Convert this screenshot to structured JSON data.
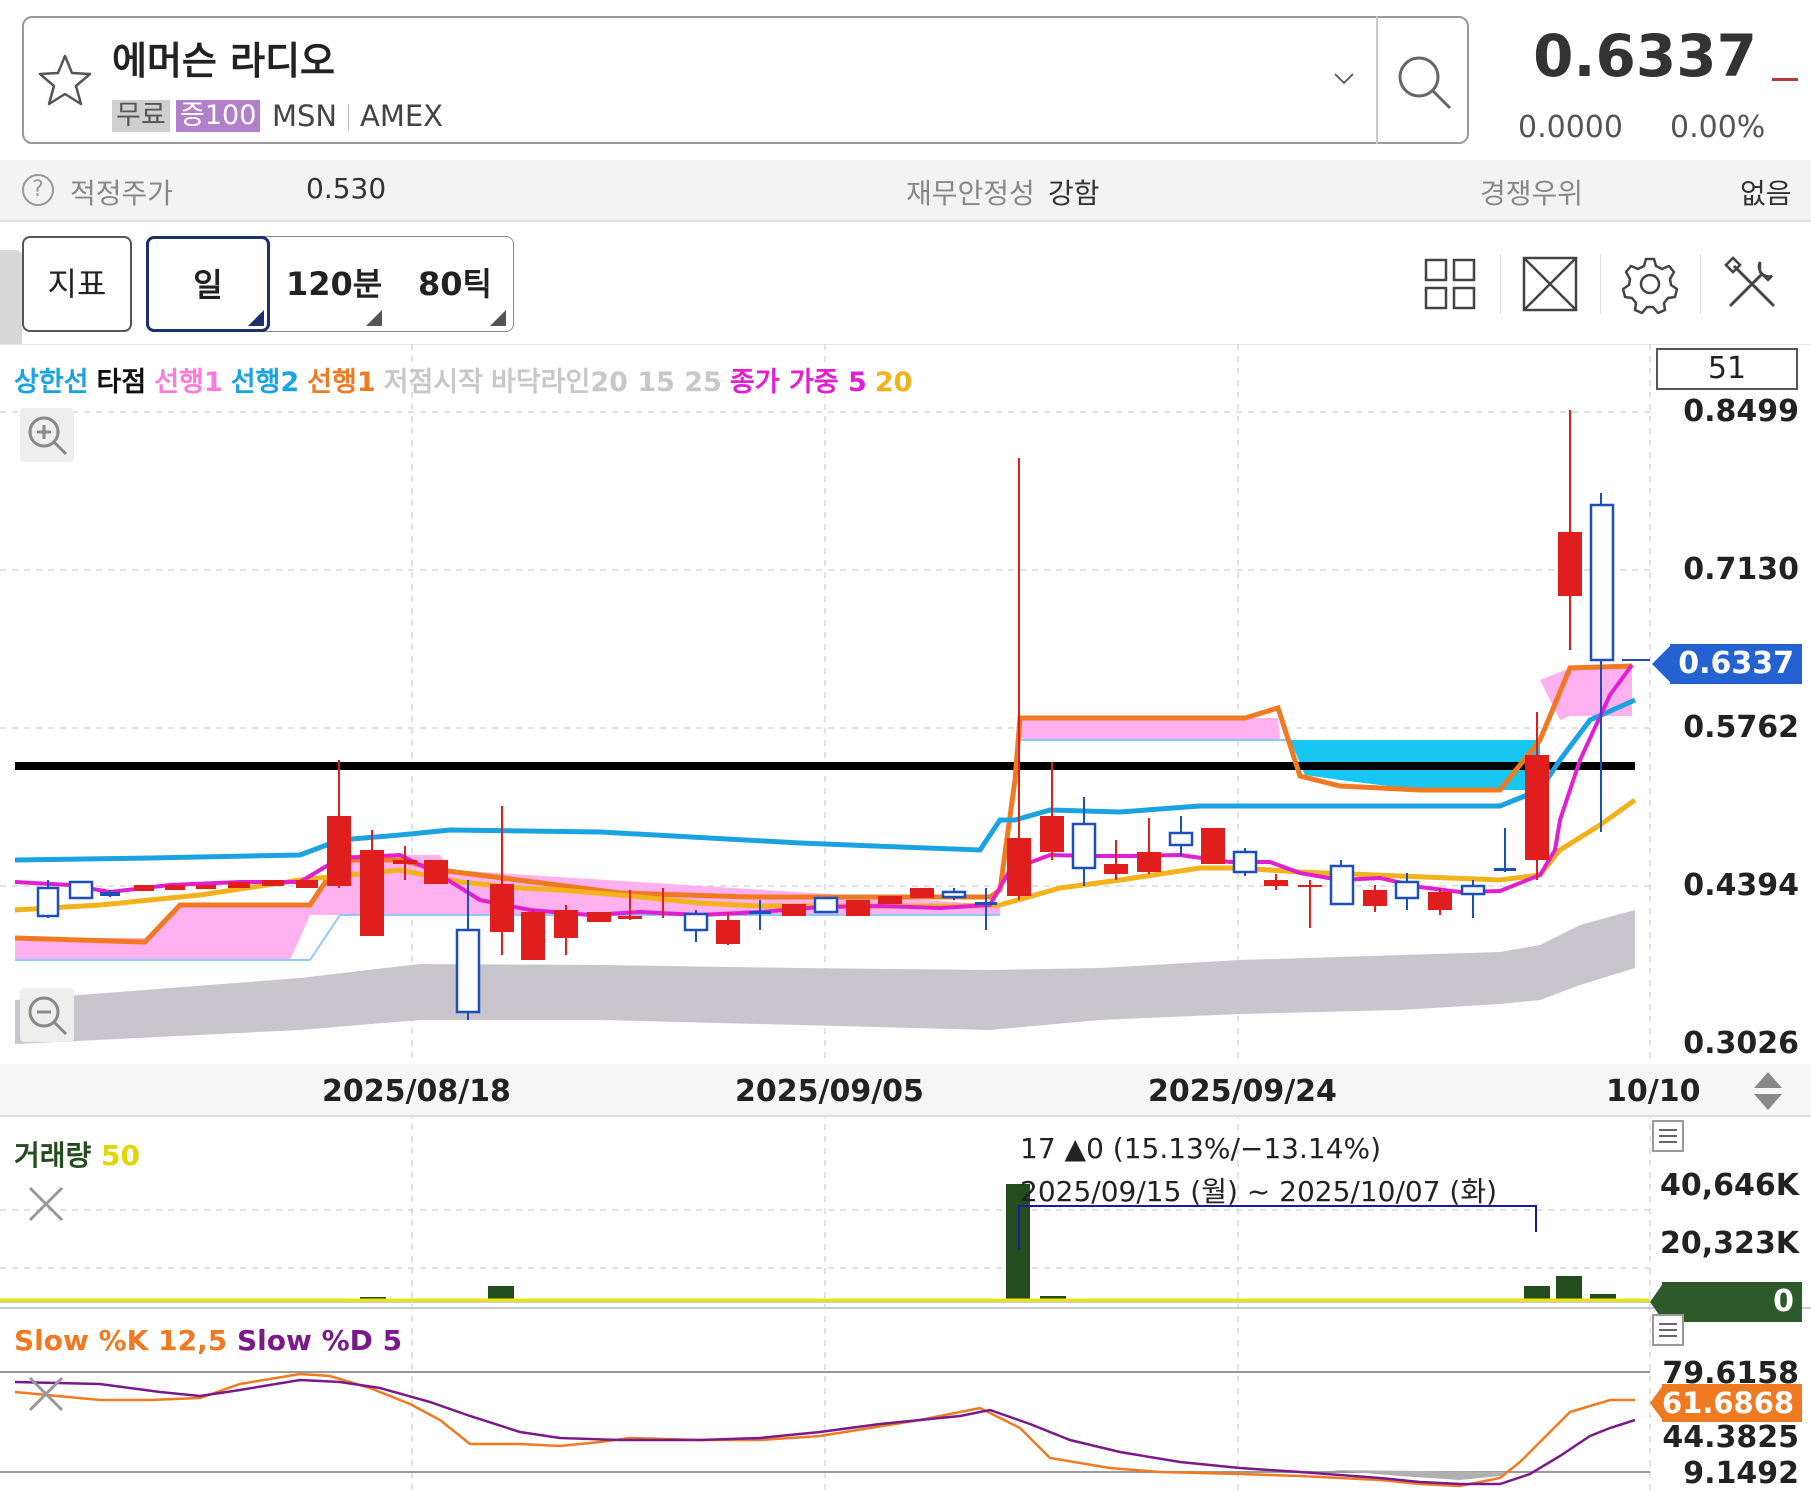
{
  "header": {
    "stock_name": "에머슨 라디오",
    "tag_free": "무료",
    "tag_margin": "증100",
    "ticker": "MSN",
    "exchange": "AMEX",
    "price": "0.6337",
    "change_abs": "0.0000",
    "change_pct": "0.00%"
  },
  "info_bar": {
    "fair_price_label": "적정주가",
    "fair_price_value": "0.530",
    "stability_label": "재무안정성",
    "stability_value": "강함",
    "competitive_label": "경쟁우위",
    "competitive_value": "없음"
  },
  "toolbar": {
    "indicator_label": "지표",
    "period_day": "일",
    "period_120min": "120분",
    "period_80tick": "80틱"
  },
  "legend": {
    "upper_line": "상한선",
    "hit_point": "타점",
    "leading1_pink": "선행1",
    "leading2": "선행2",
    "leading1_orange": "선행1",
    "low_start": "저점시작",
    "floor_line": "바닥라인20 15 25",
    "weighted_close": "종가 가중 5",
    "ma20": "20",
    "candle_count": "51"
  },
  "price_axis": {
    "labels": [
      "0.8499",
      "0.7130",
      "0.5762",
      "0.4394",
      "0.3026"
    ],
    "current": "0.6337"
  },
  "date_axis": [
    "2025/08/18",
    "2025/09/05",
    "2025/09/24",
    "10/10"
  ],
  "volume_panel": {
    "title": "거래량",
    "ma": "50",
    "stat_line": "17 ▲0 (15.13%/−13.14%)",
    "range_line": "2025/09/15 (월) ~ 2025/10/07 (화)",
    "axis_top": "40,646K",
    "axis_mid": "20,323K",
    "current": "0"
  },
  "stoch_panel": {
    "title_k": "Slow %K 12,5",
    "title_d": "Slow %D 5",
    "axis_top": "79.6158",
    "axis_mid": "44.3825",
    "axis_bottom": "9.1492",
    "current": "61.6868"
  },
  "colors": {
    "up": "#e01e1e",
    "down": "#1d4fb8",
    "upper_line": "#1aa3e0",
    "pink_line": "#ff77dd",
    "orange": "#f07a22",
    "yellow": "#f2b21c",
    "magenta": "#e020d0"
  }
}
